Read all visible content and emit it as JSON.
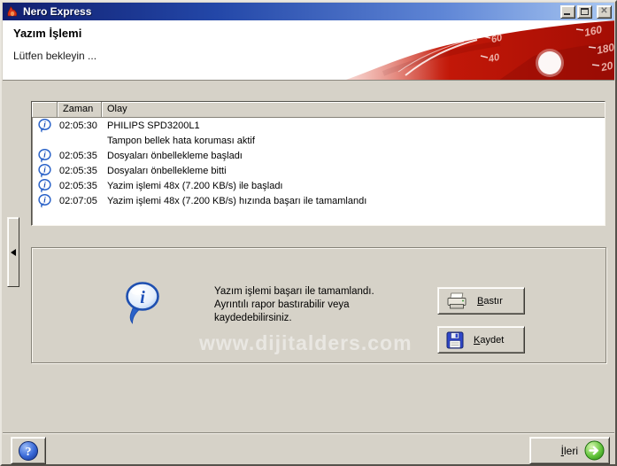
{
  "window": {
    "title": "Nero Express"
  },
  "header": {
    "title": "Yazım İşlemi",
    "subtitle": "Lütfen bekleyin ...",
    "gauge_numbers": [
      "60",
      "40",
      "160",
      "180",
      "20"
    ]
  },
  "log": {
    "columns": [
      "Zaman",
      "Olay"
    ],
    "rows": [
      {
        "icon": "info",
        "time": "02:05:30",
        "event": "PHILIPS SPD3200L1"
      },
      {
        "icon": "",
        "time": "",
        "event": "Tampon bellek hata koruması aktif"
      },
      {
        "icon": "info",
        "time": "02:05:35",
        "event": "Dosyaları önbellekleme başladı"
      },
      {
        "icon": "info",
        "time": "02:05:35",
        "event": "Dosyaları önbellekleme bitti"
      },
      {
        "icon": "info",
        "time": "02:05:35",
        "event": "Yazim işlemi 48x (7.200 KB/s) ile başladı"
      },
      {
        "icon": "info",
        "time": "02:07:05",
        "event": "Yazim işlemi 48x (7.200 KB/s) hızında başarı ile tamamlandı"
      }
    ]
  },
  "result_panel": {
    "message_lines": [
      "Yazım işlemi başarı ile tamamlandı.",
      "Ayrıntılı rapor bastırabilir veya",
      "kaydedebilirsiniz."
    ],
    "print_label": "Bastır",
    "save_label": "Kaydet"
  },
  "watermark": "www.dijitalders.com",
  "footer": {
    "next_label": "İleri"
  },
  "colors": {
    "titlebar_left": "#101e6e",
    "titlebar_right": "#aac8f2",
    "body_gray": "#d6d2c8",
    "banner_red": "#c41808",
    "info_blue": "#2a62c8",
    "next_green": "#2c8f14"
  }
}
